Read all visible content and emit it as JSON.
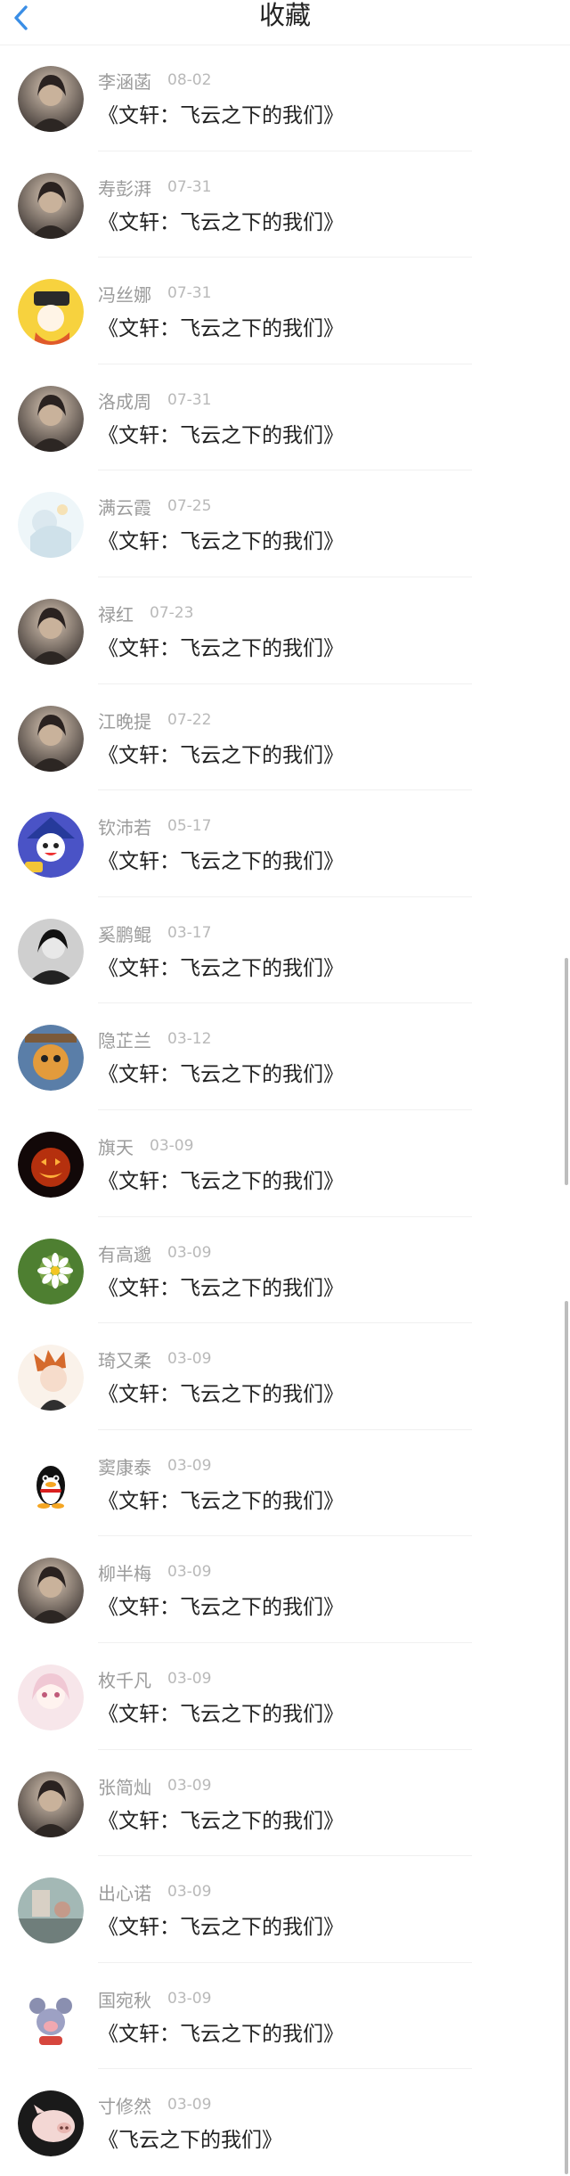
{
  "header": {
    "title": "收藏",
    "back_icon": "chevron-left-icon",
    "accent": "#3a8ee6"
  },
  "items": [
    {
      "name": "李涵菡",
      "date": "08-02",
      "text": "《文轩：飞云之下的我们》",
      "avatar": "portrait"
    },
    {
      "name": "寿彭湃",
      "date": "07-31",
      "text": "《文轩：飞云之下的我们》",
      "avatar": "portrait"
    },
    {
      "name": "冯丝娜",
      "date": "07-31",
      "text": "《文轩：飞云之下的我们》",
      "avatar": "cartoon-yellow"
    },
    {
      "name": "洛成周",
      "date": "07-31",
      "text": "《文轩：飞云之下的我们》",
      "avatar": "portrait"
    },
    {
      "name": "满云霞",
      "date": "07-25",
      "text": "《文轩：飞云之下的我们》",
      "avatar": "light"
    },
    {
      "name": "禄红",
      "date": "07-23",
      "text": "《文轩：飞云之下的我们》",
      "avatar": "portrait"
    },
    {
      "name": "江晚提",
      "date": "07-22",
      "text": "《文轩：飞云之下的我们》",
      "avatar": "portrait"
    },
    {
      "name": "钦沛若",
      "date": "05-17",
      "text": "《文轩：飞云之下的我们》",
      "avatar": "cartoon-purple"
    },
    {
      "name": "奚鹏鲲",
      "date": "03-17",
      "text": "《文轩：飞云之下的我们》",
      "avatar": "portrait-bw"
    },
    {
      "name": "隐芷兰",
      "date": "03-12",
      "text": "《文轩：飞云之下的我们》",
      "avatar": "cartoon-blue"
    },
    {
      "name": "旗天",
      "date": "03-09",
      "text": "《文轩：飞云之下的我们》",
      "avatar": "pumpkin"
    },
    {
      "name": "有高邈",
      "date": "03-09",
      "text": "《文轩：飞云之下的我们》",
      "avatar": "daisy"
    },
    {
      "name": "琦又柔",
      "date": "03-09",
      "text": "《文轩：飞云之下的我们》",
      "avatar": "anime"
    },
    {
      "name": "窦康泰",
      "date": "03-09",
      "text": "《文轩：飞云之下的我们》",
      "avatar": "penguin"
    },
    {
      "name": "柳半梅",
      "date": "03-09",
      "text": "《文轩：飞云之下的我们》",
      "avatar": "portrait"
    },
    {
      "name": "枚千凡",
      "date": "03-09",
      "text": "《文轩：飞云之下的我们》",
      "avatar": "anime-pink"
    },
    {
      "name": "张简灿",
      "date": "03-09",
      "text": "《文轩：飞云之下的我们》",
      "avatar": "portrait"
    },
    {
      "name": "出心诺",
      "date": "03-09",
      "text": "《文轩：飞云之下的我们》",
      "avatar": "scene"
    },
    {
      "name": "国宛秋",
      "date": "03-09",
      "text": "《文轩：飞云之下的我们》",
      "avatar": "cartoon-mouse"
    },
    {
      "name": "寸修然",
      "date": "03-09",
      "text": "《飞云之下的我们》",
      "avatar": "pig"
    }
  ]
}
